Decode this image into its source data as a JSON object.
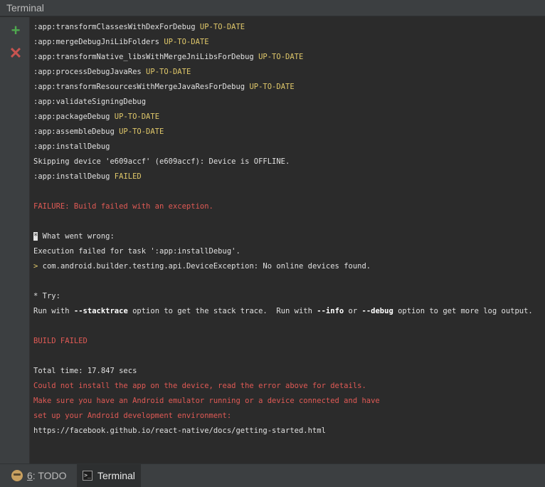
{
  "title": "Terminal",
  "side": {
    "add": "+",
    "close": "✕"
  },
  "lines": [
    {
      "t": ":app:transformClassesWithDexForDebug ",
      "s": "UP-TO-DATE"
    },
    {
      "t": ":app:mergeDebugJniLibFolders ",
      "s": "UP-TO-DATE"
    },
    {
      "t": ":app:transformNative_libsWithMergeJniLibsForDebug ",
      "s": "UP-TO-DATE"
    },
    {
      "t": ":app:processDebugJavaRes ",
      "s": "UP-TO-DATE"
    },
    {
      "t": ":app:transformResourcesWithMergeJavaResForDebug ",
      "s": "UP-TO-DATE"
    },
    {
      "t": ":app:validateSigningDebug"
    },
    {
      "t": ":app:packageDebug ",
      "s": "UP-TO-DATE"
    },
    {
      "t": ":app:assembleDebug ",
      "s": "UP-TO-DATE"
    },
    {
      "t": ":app:installDebug"
    },
    {
      "t": "Skipping device 'e609accf' (e609accf): Device is OFFLINE."
    },
    {
      "t": ":app:installDebug ",
      "s": "FAILED"
    },
    {
      "t": ""
    },
    {
      "r": "FAILURE: Build failed with an exception."
    },
    {
      "t": ""
    },
    {
      "c": "*",
      "t": " What went wrong:"
    },
    {
      "t": "Execution failed for task ':app:installDebug'."
    },
    {
      "g": "> ",
      "t": "com.android.builder.testing.api.DeviceException: No online devices found."
    },
    {
      "t": ""
    },
    {
      "t": "* Try:"
    },
    {
      "p1": "Run with ",
      "b1": "--stacktrace",
      "p2": " option to get the stack trace.  Run with ",
      "b2": "--info",
      "p3": " or ",
      "b3": "--debug",
      "p4": " option to get more log output."
    },
    {
      "t": ""
    },
    {
      "r": "BUILD FAILED"
    },
    {
      "t": ""
    },
    {
      "t": "Total time: 17.847 secs"
    },
    {
      "r": "Could not install the app on the device, read the error above for details."
    },
    {
      "r": "Make sure you have an Android emulator running or a device connected and have"
    },
    {
      "r": "set up your Android development environment:"
    },
    {
      "t": "https://facebook.github.io/react-native/docs/getting-started.html"
    }
  ],
  "tabs": {
    "todo_num": "6",
    "todo_rest": ": TODO",
    "terminal": "Terminal"
  },
  "colors": {
    "accent_yellow": "#e0c86a",
    "error_red": "#e05a55",
    "add_green": "#4fa84f"
  }
}
